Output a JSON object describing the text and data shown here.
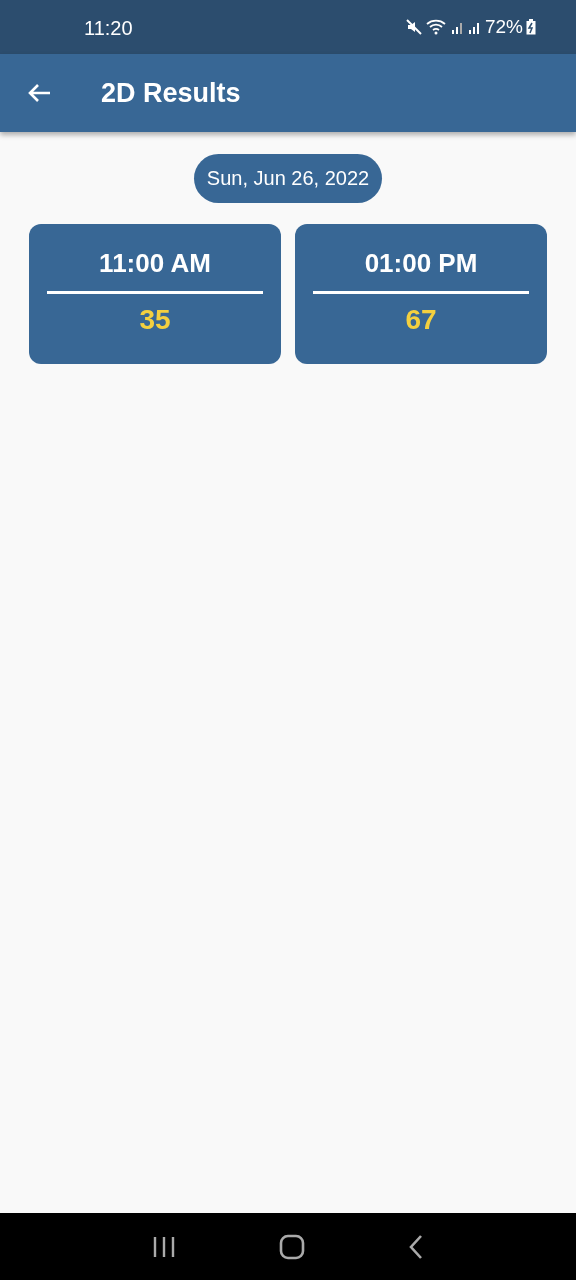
{
  "status_bar": {
    "time": "11:20",
    "battery": "72%"
  },
  "app_bar": {
    "title": "2D Results"
  },
  "date_chip": "Sun, Jun 26, 2022",
  "results": [
    {
      "time": "11:00 AM",
      "number": "35"
    },
    {
      "time": "01:00 PM",
      "number": "67"
    }
  ]
}
